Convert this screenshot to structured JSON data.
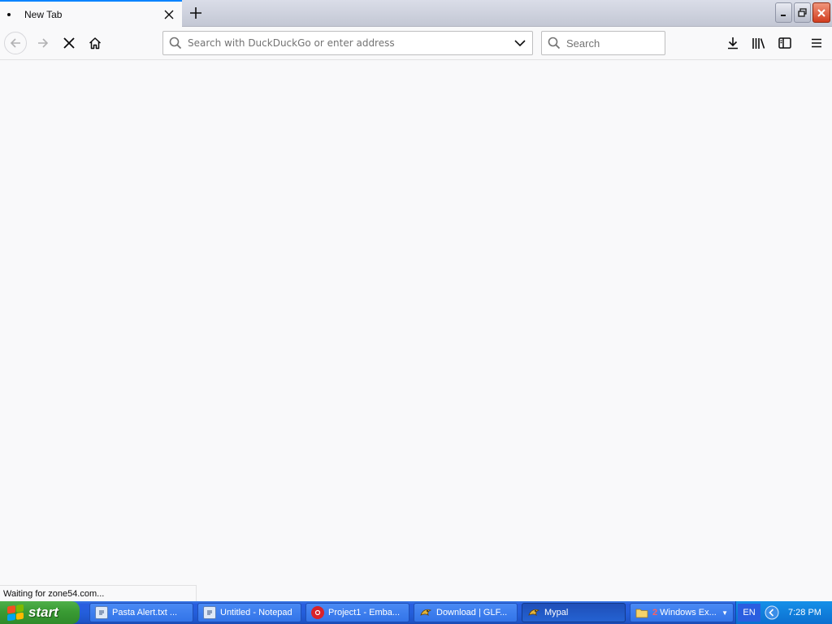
{
  "tab": {
    "title": "New Tab"
  },
  "urlbar": {
    "placeholder": "Search with DuckDuckGo or enter address",
    "value": ""
  },
  "searchbar": {
    "placeholder": "Search"
  },
  "status": {
    "text": "Waiting for zone54.com..."
  },
  "taskbar": {
    "start_label": "start",
    "tasks": [
      {
        "label": "Pasta Alert.txt ...",
        "icon": "notepad-icon"
      },
      {
        "label": "Untitled - Notepad",
        "icon": "notepad-icon"
      },
      {
        "label": "Project1 - Emba...",
        "icon": "embarcadero-icon"
      },
      {
        "label": "Download | GLF...",
        "icon": "mypal-icon"
      },
      {
        "label": "Mypal",
        "icon": "mypal-icon",
        "active": true
      },
      {
        "label": "Windows Ex...",
        "count": "2",
        "icon": "folder-icon"
      }
    ],
    "tray": {
      "language": "EN",
      "clock": "7:28 PM"
    }
  },
  "colors": {
    "accent": "#0a84ff",
    "taskbar": "#245edb",
    "start": "#3a9b34",
    "close": "#d23d1f"
  }
}
